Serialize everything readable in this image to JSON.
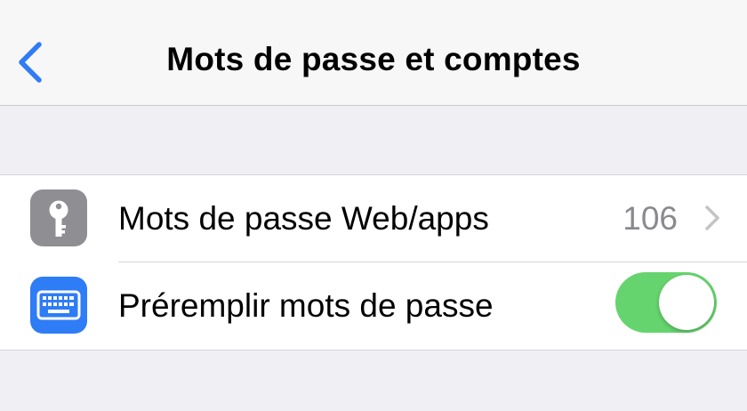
{
  "navbar": {
    "title": "Mots de passe et comptes",
    "back_icon": "chevron-left-icon",
    "accent_color": "#2f7cf6"
  },
  "settings": {
    "items": [
      {
        "label": "Mots de passe Web/apps",
        "icon": "key-icon",
        "icon_color": "#8e8e93",
        "value": "106",
        "accessory": "chevron-right-icon"
      },
      {
        "label": "Préremplir mots de passe",
        "icon": "keyboard-icon",
        "icon_color": "#2e7cf6",
        "toggle_on": true,
        "toggle_color": "#65d46e"
      }
    ]
  }
}
